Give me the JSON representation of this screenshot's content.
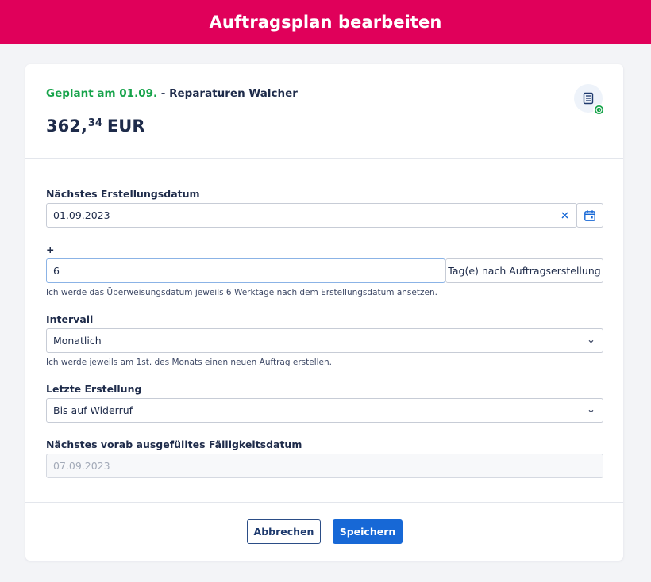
{
  "header": {
    "title": "Auftragsplan bearbeiten"
  },
  "summary": {
    "planned_text": "Geplant am 01.09.",
    "separator_name": " - Reparaturen Walcher",
    "amount_integer": "362,",
    "amount_decimal": "34",
    "currency": "EUR",
    "status_icon": "document-list-icon",
    "status_badge_icon": "clock-badge-icon",
    "badge_color": "#16a34a"
  },
  "next_creation": {
    "label": "Nächstes Erstellungsdatum",
    "value": "01.09.2023"
  },
  "offset": {
    "label": "+",
    "value": "6",
    "addon": "Tag(e) nach Auftragserstellung",
    "hint": "Ich werde das Überweisungsdatum jeweils 6 Werktage nach dem Erstellungsdatum ansetzen."
  },
  "interval": {
    "label": "Intervall",
    "selected": "Monatlich",
    "hint": "Ich werde jeweils am 1st. des Monats einen neuen Auftrag erstellen."
  },
  "last_creation": {
    "label": "Letzte Erstellung",
    "selected": "Bis auf Widerruf"
  },
  "next_due": {
    "label": "Nächstes vorab ausgefülltes Fälligkeitsdatum",
    "value": "07.09.2023"
  },
  "actions": {
    "cancel_label": "Abbrechen",
    "save_label": "Speichern"
  },
  "colors": {
    "header_bg": "#e0005a",
    "primary": "#1768d6",
    "success": "#16a34a"
  }
}
